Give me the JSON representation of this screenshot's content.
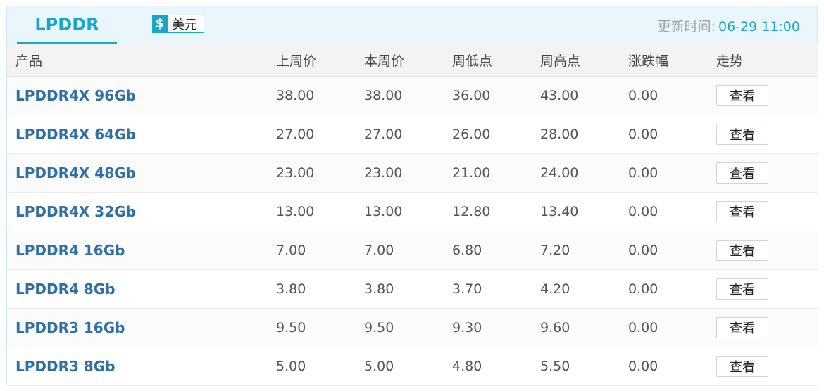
{
  "header": {
    "tab_label": "LPDDR",
    "currency_symbol": "$",
    "currency_label": "美元",
    "updated_label": "更新时间:",
    "updated_time": "06-29 11:00"
  },
  "table": {
    "columns": [
      "产品",
      "上周价",
      "本周价",
      "周低点",
      "周高点",
      "涨跌幅",
      "走势"
    ],
    "view_label": "查看",
    "rows": [
      {
        "product": "LPDDR4X 96Gb",
        "last_week": "38.00",
        "this_week": "38.00",
        "week_low": "36.00",
        "week_high": "43.00",
        "change": "0.00"
      },
      {
        "product": "LPDDR4X 64Gb",
        "last_week": "27.00",
        "this_week": "27.00",
        "week_low": "26.00",
        "week_high": "28.00",
        "change": "0.00"
      },
      {
        "product": "LPDDR4X 48Gb",
        "last_week": "23.00",
        "this_week": "23.00",
        "week_low": "21.00",
        "week_high": "24.00",
        "change": "0.00"
      },
      {
        "product": "LPDDR4X 32Gb",
        "last_week": "13.00",
        "this_week": "13.00",
        "week_low": "12.80",
        "week_high": "13.40",
        "change": "0.00"
      },
      {
        "product": "LPDDR4 16Gb",
        "last_week": "7.00",
        "this_week": "7.00",
        "week_low": "6.80",
        "week_high": "7.20",
        "change": "0.00"
      },
      {
        "product": "LPDDR4 8Gb",
        "last_week": "3.80",
        "this_week": "3.80",
        "week_low": "3.70",
        "week_high": "4.20",
        "change": "0.00"
      },
      {
        "product": "LPDDR3 16Gb",
        "last_week": "9.50",
        "this_week": "9.50",
        "week_low": "9.30",
        "week_high": "9.60",
        "change": "0.00"
      },
      {
        "product": "LPDDR3 8Gb",
        "last_week": "5.00",
        "this_week": "5.00",
        "week_low": "4.80",
        "week_high": "5.50",
        "change": "0.00"
      }
    ]
  },
  "colors": {
    "accent": "#1aa6c9",
    "product_text": "#2f6fa7",
    "header_bg": "#e9f7fc"
  },
  "icons": {
    "currency": "dollar-icon"
  }
}
